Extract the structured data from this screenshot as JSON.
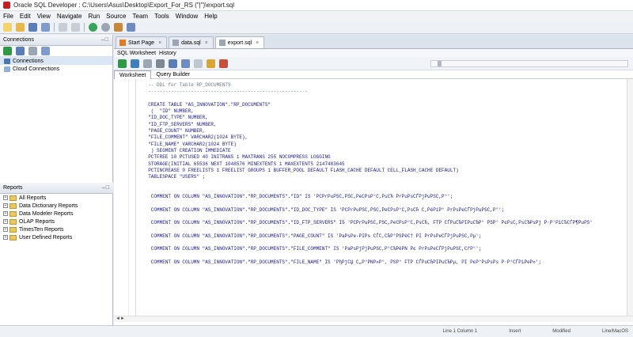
{
  "window": {
    "title": "Oracle SQL Developer : C:\\Users\\Asus\\Desktop\\Export_For_RS (\"|\")\\export.sql"
  },
  "menu": [
    "File",
    "Edit",
    "View",
    "Navigate",
    "Run",
    "Source",
    "Team",
    "Tools",
    "Window",
    "Help"
  ],
  "left": {
    "connections_header": "Connections",
    "connections_items": [
      "Connections",
      "Cloud Connections"
    ],
    "reports_header": "Reports",
    "reports_items": [
      "All Reports",
      "Data Dictionary Reports",
      "Data Modeler Reports",
      "OLAP Reports",
      "TimesTen Reports",
      "User Defined Reports"
    ]
  },
  "doc_tabs": [
    "Start Page",
    "data.sql",
    "export.sql"
  ],
  "sub_tabs": [
    "SQL Worksheet",
    "History"
  ],
  "ws_tabs": [
    "Worksheet",
    "Query Builder"
  ],
  "code_lines": [
    {
      "t": "  -- DDL for Table RP_DOCUMENTS",
      "c": "cmt"
    },
    {
      "t": "  --------------------------------------------------------",
      "c": "cmt"
    },
    {
      "t": "",
      "c": ""
    },
    {
      "t": "  CREATE TABLE \"AS_INNOVATION\".\"RP_DOCUMENTS\"",
      "c": "kw"
    },
    {
      "t": "   (  \"ID\" NUMBER,",
      "c": "kw"
    },
    {
      "t": "  \"ID_DOC_TYPE\" NUMBER,",
      "c": "kw"
    },
    {
      "t": "  \"ID_FTP_SERVERS\" NUMBER,",
      "c": "kw"
    },
    {
      "t": "  \"PAGE_COUNT\" NUMBER,",
      "c": "kw"
    },
    {
      "t": "  \"FILE_COMMENT\" VARCHAR2(1024 BYTE),",
      "c": "kw"
    },
    {
      "t": "  \"FILE_NAME\" VARCHAR2(1024 BYTE)",
      "c": "kw"
    },
    {
      "t": "   ) SEGMENT CREATION IMMEDIATE",
      "c": "kw"
    },
    {
      "t": "  PCTFREE 10 PCTUSED 40 INITRANS 1 MAXTRANS 255 NOCOMPRESS LOGGING",
      "c": "kw"
    },
    {
      "t": "  STORAGE(INITIAL 65536 NEXT 1048576 MINEXTENTS 1 MAXEXTENTS 2147483645",
      "c": "kw"
    },
    {
      "t": "  PCTINCREASE 0 FREELISTS 1 FREELIST GROUPS 1 BUFFER_POOL DEFAULT FLASH_CACHE DEFAULT CELL_FLASH_CACHE DEFAULT)",
      "c": "kw"
    },
    {
      "t": "  TABLESPACE \"USERS\" ;",
      "c": "kw"
    },
    {
      "t": "",
      "c": ""
    },
    {
      "t": "",
      "c": ""
    },
    {
      "t": "   COMMENT ON COLUMN \"AS_INNOVATION\".\"RP_DOCUMENTS\".\"ID\" IS 'PCPrPuPSC,PSC,PeCPsP°C,PsCЋ PrPuPsCЃPjPuPSC,P°';",
      "c": "kw"
    },
    {
      "t": "",
      "c": ""
    },
    {
      "t": "   COMMENT ON COLUMN \"AS_INNOVATION\".\"RP_DOCUMENTS\".\"ID_DOC_TYPE\" IS 'PCPrPuPSC,PSC,PeCPsP°C,PsCЋ C,PëPїP° PrPsPeCЃPjPuPSC,P°';",
      "c": "kw"
    },
    {
      "t": "",
      "c": ""
    },
    {
      "t": "   COMMENT ON COLUMN \"AS_INNOVATION\".\"RP_DOCUMENTS\".\"ID_FTP_SERVERS\" IS 'PCPrPuPSC,PSC,PeCPsP°C,PsCЋ, FTP CЃPuCЂPIPuCЂP° PSP° PєPsC,PsCЂPsPj P·P°PiCЂCЃP¶PuPS'",
      "c": "kw"
    },
    {
      "t": "",
      "c": ""
    },
    {
      "t": "   COMMENT ON COLUMN \"AS_INNOVATION\".\"RP_DOCUMENTS\".\"PAGE_COUNT\" IS 'PaPsPe-PIPs CЃC,CЂP°PSPёC† PI PrPsPeCЃPjPuPSC,Pµ';",
      "c": "kw"
    },
    {
      "t": "",
      "c": ""
    },
    {
      "t": "   COMMENT ON COLUMN \"AS_INNOVATION\".\"RP_DOCUMENTS\".\"FILE_COMMENT\" IS 'PaPsPjPjPuPSC,P°CЂPëPN Pє PrPsPeCЃPjPuPSC,CѓP°';",
      "c": "kw"
    },
    {
      "t": "",
      "c": ""
    },
    {
      "t": "   COMMENT ON COLUMN \"AS_INNOVATION\".\"RP_DOCUMENTS\".\"FILE_NAME\" IS 'PђPjCЏ C„P°PNP»P°, PSP° FTP CЃPuCЂPIPuCЂPµ, PI PєP°PsPsPs P·P°CЃPiPeP»';",
      "c": "kw"
    }
  ],
  "status": [
    "Line 1 Column 1",
    "Insert",
    "Modified",
    "Line/MacOS"
  ]
}
